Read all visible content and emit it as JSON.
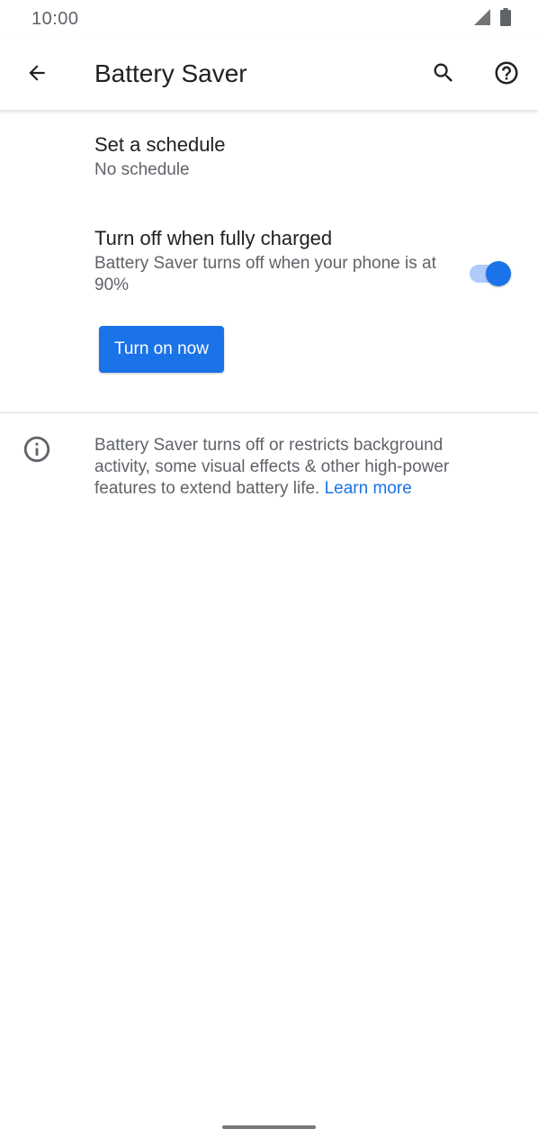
{
  "status_bar": {
    "time": "10:00",
    "icons": [
      "signal-icon",
      "battery-icon"
    ]
  },
  "app_bar": {
    "title": "Battery Saver",
    "icons": [
      "back-arrow-icon",
      "search-icon",
      "help-icon"
    ]
  },
  "preferences": [
    {
      "title": "Set a schedule",
      "summary": "No schedule"
    },
    {
      "title": "Turn off when fully charged",
      "summary": "Battery Saver turns off when your phone is at 90%",
      "switch_on": true
    }
  ],
  "button": {
    "label": "Turn on now"
  },
  "footer": {
    "icon": "info-icon",
    "text": "Battery Saver turns off or restricts background activity, some visual effects & other high-power features to extend battery life.",
    "link": "Learn more"
  },
  "colors": {
    "accent": "#1a73e8",
    "switch_track": "#aecbfa",
    "secondary_text": "#5f6368",
    "primary_text": "#202124"
  }
}
